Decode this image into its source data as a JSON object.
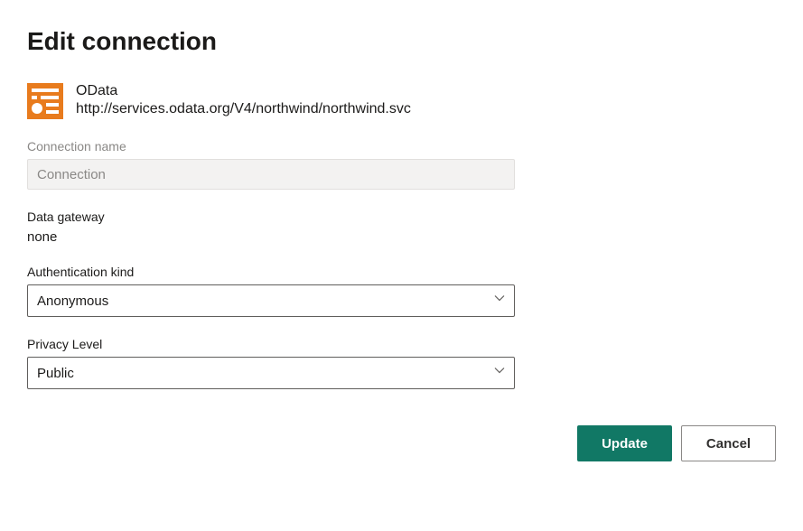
{
  "title": "Edit connection",
  "source": {
    "name": "OData",
    "url": "http://services.odata.org/V4/northwind/northwind.svc"
  },
  "connection_name": {
    "label": "Connection name",
    "value": "",
    "placeholder": "Connection"
  },
  "data_gateway": {
    "label": "Data gateway",
    "value": "none"
  },
  "authentication_kind": {
    "label": "Authentication kind",
    "selected": "Anonymous"
  },
  "privacy_level": {
    "label": "Privacy Level",
    "selected": "Public"
  },
  "buttons": {
    "update": "Update",
    "cancel": "Cancel"
  }
}
